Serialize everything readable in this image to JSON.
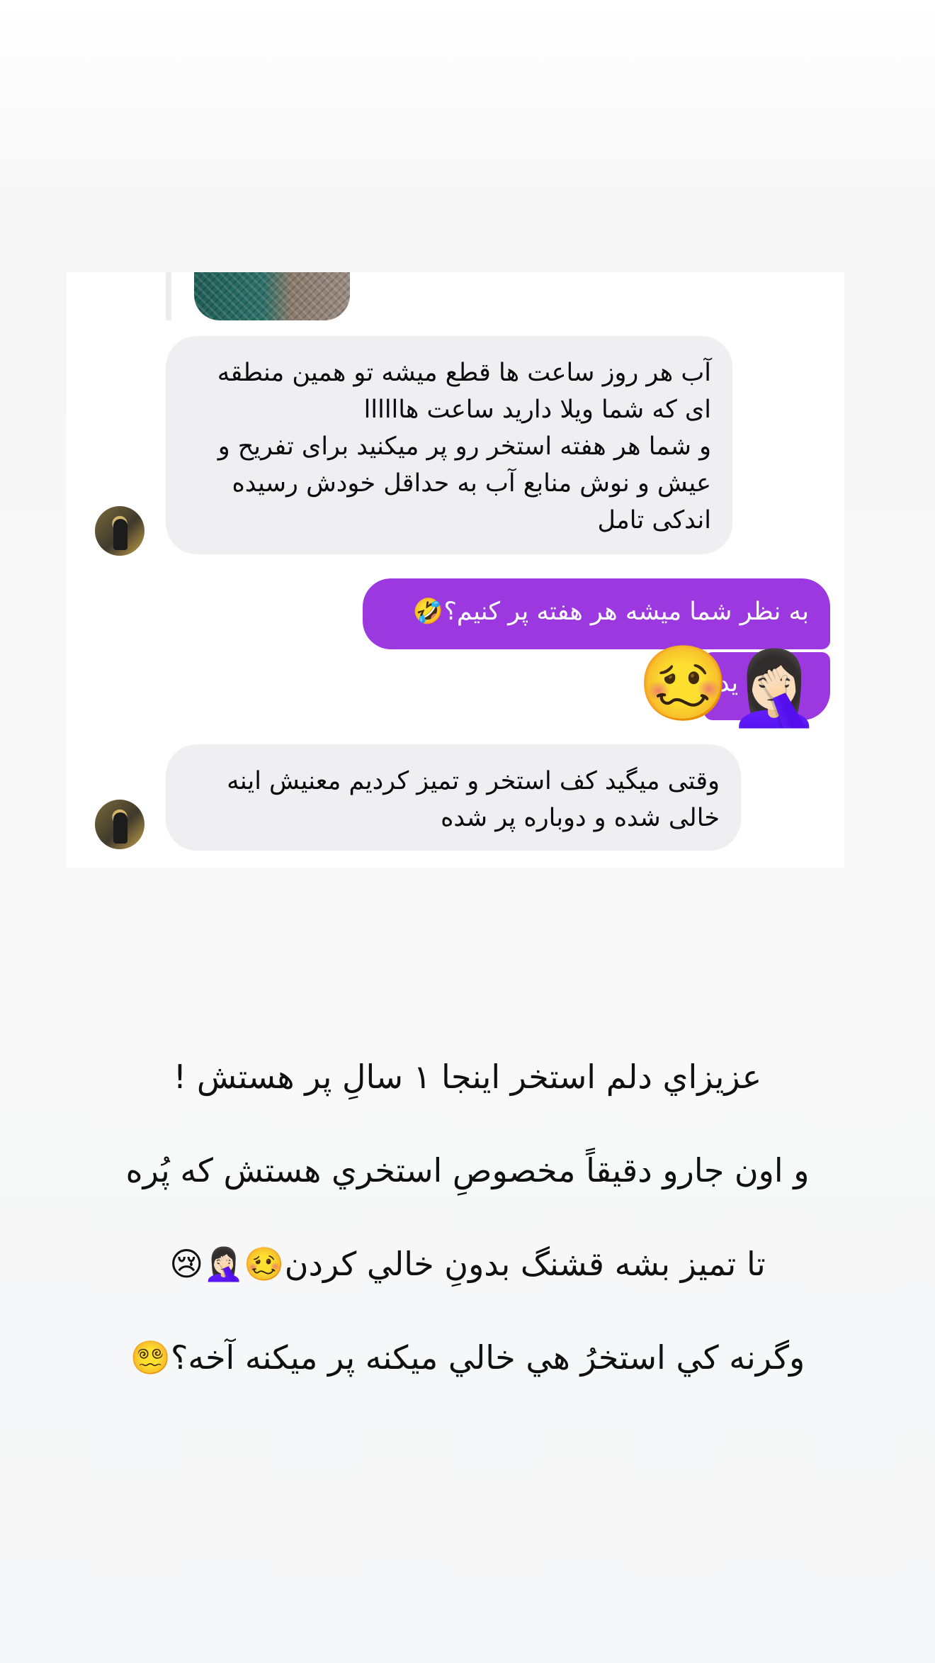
{
  "thread": {
    "messages": [
      {
        "id": "in1",
        "text": "آب هر روز ساعت ها قطع میشه تو همین منطقه\nای که شما ویلا دارید ساعت هاااااا\nو شما هر هفته استخر رو پر میکنید برای تفریح و\nعیش و نوش منابع آب به حداقل خودش رسیده\nاندکی تامل"
      },
      {
        "id": "out1",
        "text": "به نظر شما میشه هر هفته پر کنیم؟🤣"
      },
      {
        "id": "out2",
        "text": "ید"
      },
      {
        "id": "in2",
        "text": "وقتی میگید کف استخر و تمیز کردیم معنیش اینه\nخالی شده و دوباره پر شده"
      }
    ],
    "reaction_emojis": [
      "🥴",
      "🤦🏻‍♀️"
    ]
  },
  "caption": {
    "lines": [
      "عزيزاي دلم استخر اينجا ١ سالِ پر هستش !",
      "و اون جارو دقيقاً مخصوصِ استخري هستش كه پُره",
      "تا تميز بشه قشنگ بدونِ خالي كردن🥴🤦🏻‍♀️😢",
      "وگرنه كي استخرُ هي خالي ميكنه پر ميكنه آخه؟😵‍💫"
    ]
  },
  "colors": {
    "outgoing_bubble": "#9b38e0",
    "incoming_bubble": "#efeff1"
  }
}
